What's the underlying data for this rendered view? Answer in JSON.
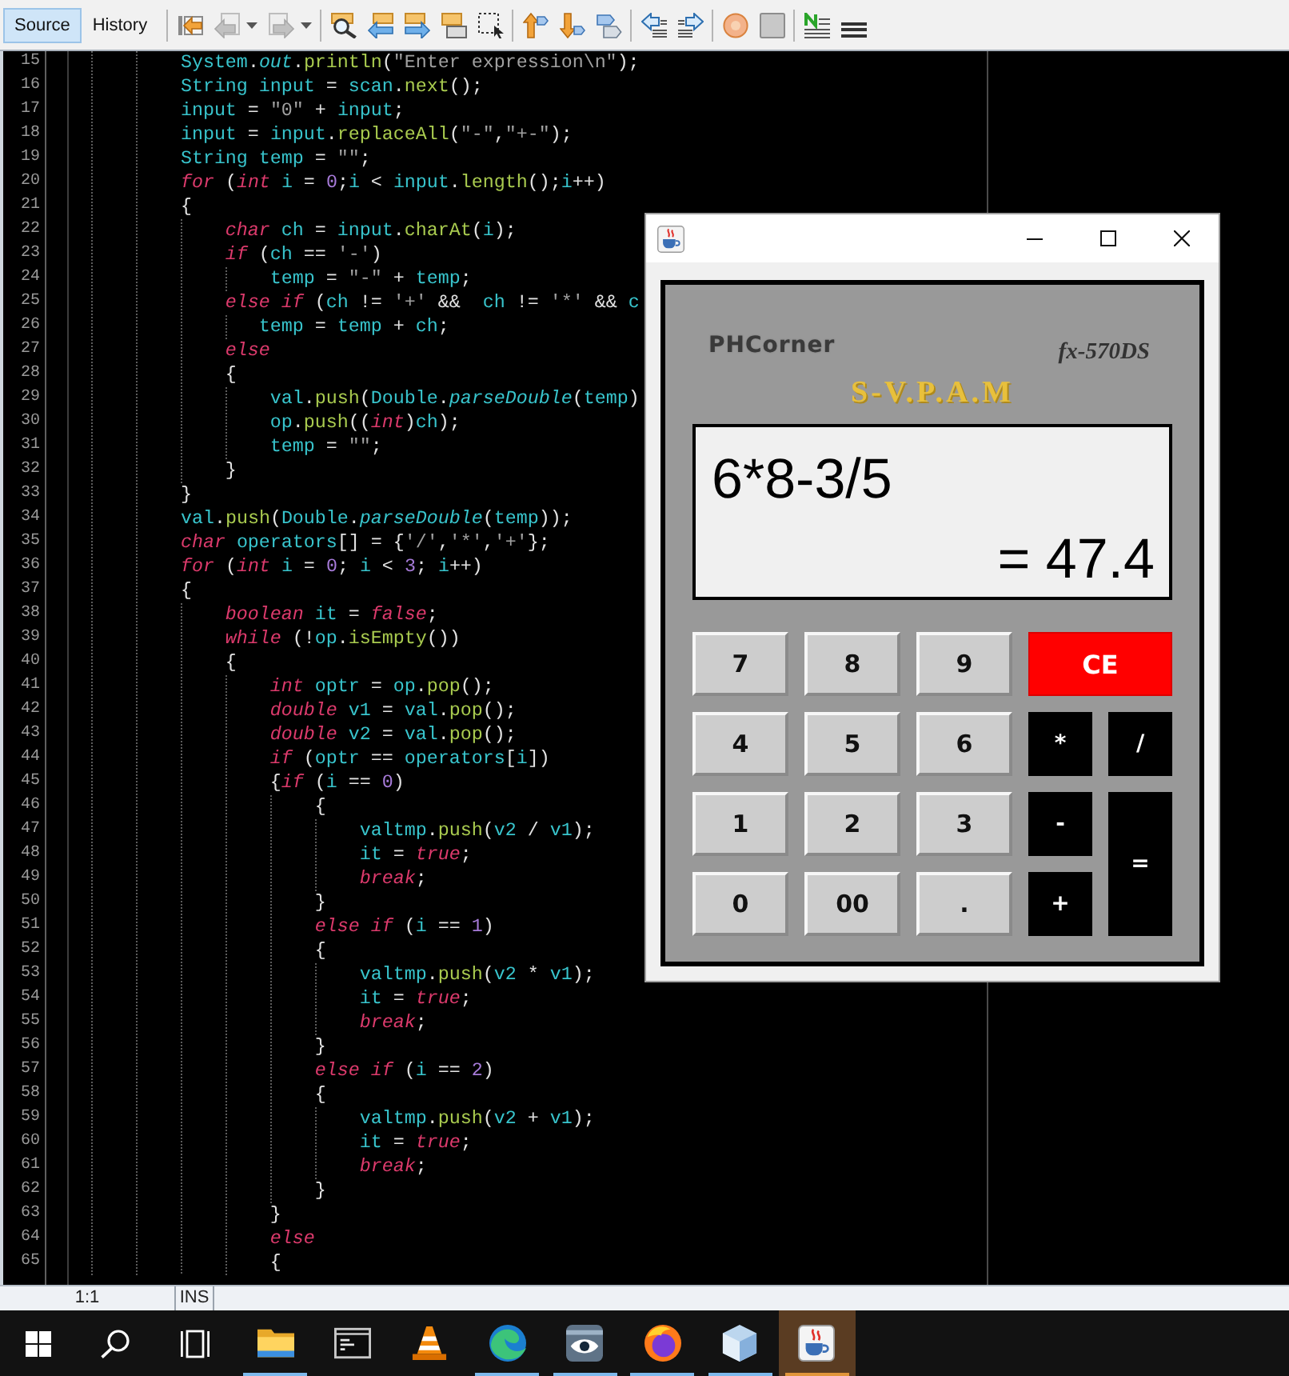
{
  "toolbar": {
    "tabs": [
      {
        "label": "Source",
        "selected": true
      },
      {
        "label": "History",
        "selected": false
      }
    ],
    "groups": [
      {
        "buttons": [
          {
            "kind": "last-edit",
            "disabled": false,
            "menu": false
          },
          {
            "kind": "back",
            "disabled": true,
            "menu": true
          },
          {
            "kind": "forward",
            "disabled": true,
            "menu": true
          }
        ]
      },
      {
        "buttons": [
          {
            "kind": "find",
            "disabled": false,
            "menu": false
          },
          {
            "kind": "find-previous",
            "disabled": false,
            "menu": false
          },
          {
            "kind": "find-next",
            "disabled": false,
            "menu": false
          },
          {
            "kind": "highlight",
            "disabled": false,
            "menu": false
          },
          {
            "kind": "rect-select",
            "disabled": false,
            "menu": false
          }
        ]
      },
      {
        "buttons": [
          {
            "kind": "previous-bookmark",
            "disabled": false,
            "menu": false
          },
          {
            "kind": "next-bookmark",
            "disabled": false,
            "menu": false
          },
          {
            "kind": "toggle-bookmark",
            "disabled": false,
            "menu": false
          }
        ]
      },
      {
        "buttons": [
          {
            "kind": "shift-left",
            "disabled": false,
            "menu": false
          },
          {
            "kind": "shift-right",
            "disabled": false,
            "menu": false
          }
        ]
      },
      {
        "buttons": [
          {
            "kind": "record",
            "disabled": false,
            "menu": false
          },
          {
            "kind": "stop",
            "disabled": false,
            "menu": false
          }
        ]
      },
      {
        "buttons": [
          {
            "kind": "comment",
            "disabled": false,
            "menu": false
          },
          {
            "kind": "uncomment",
            "disabled": false,
            "menu": false
          }
        ]
      }
    ]
  },
  "editor": {
    "lines": [
      {
        "number": "15",
        "tokens": [
          {
            "kind": "name",
            "text": "            System"
          },
          {
            "kind": "plain",
            "text": "."
          },
          {
            "kind": "field",
            "text": "out"
          },
          {
            "kind": "plain",
            "text": "."
          },
          {
            "kind": "method",
            "text": "println"
          },
          {
            "kind": "plain",
            "text": "("
          },
          {
            "kind": "string",
            "text": "\"Enter expression\\n\""
          },
          {
            "kind": "plain",
            "text": ");"
          }
        ]
      },
      {
        "number": "16",
        "tokens": [
          {
            "kind": "name",
            "text": "            String "
          },
          {
            "kind": "name",
            "text": "input"
          },
          {
            "kind": "plain",
            "text": " = "
          },
          {
            "kind": "name",
            "text": "scan"
          },
          {
            "kind": "plain",
            "text": "."
          },
          {
            "kind": "method",
            "text": "next"
          },
          {
            "kind": "plain",
            "text": "();"
          }
        ]
      },
      {
        "number": "17",
        "tokens": [
          {
            "kind": "name",
            "text": "            input"
          },
          {
            "kind": "plain",
            "text": " = "
          },
          {
            "kind": "string",
            "text": "\"0\""
          },
          {
            "kind": "plain",
            "text": " + "
          },
          {
            "kind": "name",
            "text": "input"
          },
          {
            "kind": "plain",
            "text": ";"
          }
        ]
      },
      {
        "number": "18",
        "tokens": [
          {
            "kind": "name",
            "text": "            input"
          },
          {
            "kind": "plain",
            "text": " = "
          },
          {
            "kind": "name",
            "text": "input"
          },
          {
            "kind": "plain",
            "text": "."
          },
          {
            "kind": "method",
            "text": "replaceAll"
          },
          {
            "kind": "plain",
            "text": "("
          },
          {
            "kind": "string",
            "text": "\"-\""
          },
          {
            "kind": "plain",
            "text": ","
          },
          {
            "kind": "string",
            "text": "\"+-\""
          },
          {
            "kind": "plain",
            "text": ");"
          }
        ]
      },
      {
        "number": "19",
        "tokens": [
          {
            "kind": "name",
            "text": "            String "
          },
          {
            "kind": "name",
            "text": "temp"
          },
          {
            "kind": "plain",
            "text": " = "
          },
          {
            "kind": "string",
            "text": "\"\""
          },
          {
            "kind": "plain",
            "text": ";"
          }
        ]
      },
      {
        "number": "20",
        "tokens": [
          {
            "kind": "keyword",
            "text": "            for"
          },
          {
            "kind": "plain",
            "text": " ("
          },
          {
            "kind": "keyword",
            "text": "int "
          },
          {
            "kind": "name",
            "text": "i"
          },
          {
            "kind": "plain",
            "text": " = "
          },
          {
            "kind": "number",
            "text": "0"
          },
          {
            "kind": "plain",
            "text": ";"
          },
          {
            "kind": "name",
            "text": "i"
          },
          {
            "kind": "plain",
            "text": " < "
          },
          {
            "kind": "name",
            "text": "input"
          },
          {
            "kind": "plain",
            "text": "."
          },
          {
            "kind": "method",
            "text": "length"
          },
          {
            "kind": "plain",
            "text": "();"
          },
          {
            "kind": "name",
            "text": "i"
          },
          {
            "kind": "plain",
            "text": "++)"
          }
        ]
      },
      {
        "number": "21",
        "tokens": [
          {
            "kind": "plain",
            "text": "            {"
          }
        ]
      },
      {
        "number": "22",
        "tokens": [
          {
            "kind": "keyword",
            "text": "                char "
          },
          {
            "kind": "name",
            "text": "ch"
          },
          {
            "kind": "plain",
            "text": " = "
          },
          {
            "kind": "name",
            "text": "input"
          },
          {
            "kind": "plain",
            "text": "."
          },
          {
            "kind": "method",
            "text": "charAt"
          },
          {
            "kind": "plain",
            "text": "("
          },
          {
            "kind": "name",
            "text": "i"
          },
          {
            "kind": "plain",
            "text": ");"
          }
        ]
      },
      {
        "number": "23",
        "tokens": [
          {
            "kind": "keyword",
            "text": "                if"
          },
          {
            "kind": "plain",
            "text": " ("
          },
          {
            "kind": "name",
            "text": "ch"
          },
          {
            "kind": "plain",
            "text": " == "
          },
          {
            "kind": "string",
            "text": "'-'"
          },
          {
            "kind": "plain",
            "text": ")"
          }
        ]
      },
      {
        "number": "24",
        "tokens": [
          {
            "kind": "name",
            "text": "                    temp"
          },
          {
            "kind": "plain",
            "text": " = "
          },
          {
            "kind": "string",
            "text": "\"-\""
          },
          {
            "kind": "plain",
            "text": " + "
          },
          {
            "kind": "name",
            "text": "temp"
          },
          {
            "kind": "plain",
            "text": ";"
          }
        ]
      },
      {
        "number": "25",
        "tokens": [
          {
            "kind": "keyword",
            "text": "                else if"
          },
          {
            "kind": "plain",
            "text": " ("
          },
          {
            "kind": "name",
            "text": "ch"
          },
          {
            "kind": "plain",
            "text": " != "
          },
          {
            "kind": "string",
            "text": "'+'"
          },
          {
            "kind": "plain",
            "text": " &&  "
          },
          {
            "kind": "name",
            "text": "ch"
          },
          {
            "kind": "plain",
            "text": " != "
          },
          {
            "kind": "string",
            "text": "'*'"
          },
          {
            "kind": "plain",
            "text": " && "
          },
          {
            "kind": "name",
            "text": "c"
          }
        ]
      },
      {
        "number": "26",
        "tokens": [
          {
            "kind": "name",
            "text": "                   temp"
          },
          {
            "kind": "plain",
            "text": " = "
          },
          {
            "kind": "name",
            "text": "temp"
          },
          {
            "kind": "plain",
            "text": " + "
          },
          {
            "kind": "name",
            "text": "ch"
          },
          {
            "kind": "plain",
            "text": ";"
          }
        ]
      },
      {
        "number": "27",
        "tokens": [
          {
            "kind": "keyword",
            "text": "                else"
          }
        ]
      },
      {
        "number": "28",
        "tokens": [
          {
            "kind": "plain",
            "text": "                {"
          }
        ]
      },
      {
        "number": "29",
        "tokens": [
          {
            "kind": "name",
            "text": "                    val"
          },
          {
            "kind": "plain",
            "text": "."
          },
          {
            "kind": "method",
            "text": "push"
          },
          {
            "kind": "plain",
            "text": "("
          },
          {
            "kind": "name",
            "text": "Double"
          },
          {
            "kind": "plain",
            "text": "."
          },
          {
            "kind": "field",
            "text": "parseDouble"
          },
          {
            "kind": "plain",
            "text": "("
          },
          {
            "kind": "name",
            "text": "temp"
          },
          {
            "kind": "plain",
            "text": ")"
          }
        ]
      },
      {
        "number": "30",
        "tokens": [
          {
            "kind": "name",
            "text": "                    op"
          },
          {
            "kind": "plain",
            "text": "."
          },
          {
            "kind": "method",
            "text": "push"
          },
          {
            "kind": "plain",
            "text": "(("
          },
          {
            "kind": "keyword",
            "text": "int"
          },
          {
            "kind": "plain",
            "text": ")"
          },
          {
            "kind": "name",
            "text": "ch"
          },
          {
            "kind": "plain",
            "text": ");"
          }
        ]
      },
      {
        "number": "31",
        "tokens": [
          {
            "kind": "name",
            "text": "                    temp"
          },
          {
            "kind": "plain",
            "text": " = "
          },
          {
            "kind": "string",
            "text": "\"\""
          },
          {
            "kind": "plain",
            "text": ";"
          }
        ]
      },
      {
        "number": "32",
        "tokens": [
          {
            "kind": "plain",
            "text": "                }"
          }
        ]
      },
      {
        "number": "33",
        "tokens": [
          {
            "kind": "plain",
            "text": "            }"
          }
        ]
      },
      {
        "number": "34",
        "tokens": [
          {
            "kind": "name",
            "text": "            val"
          },
          {
            "kind": "plain",
            "text": "."
          },
          {
            "kind": "method",
            "text": "push"
          },
          {
            "kind": "plain",
            "text": "("
          },
          {
            "kind": "name",
            "text": "Double"
          },
          {
            "kind": "plain",
            "text": "."
          },
          {
            "kind": "field",
            "text": "parseDouble"
          },
          {
            "kind": "plain",
            "text": "("
          },
          {
            "kind": "name",
            "text": "temp"
          },
          {
            "kind": "plain",
            "text": "));"
          }
        ]
      },
      {
        "number": "35",
        "tokens": [
          {
            "kind": "keyword",
            "text": "            char "
          },
          {
            "kind": "name",
            "text": "operators"
          },
          {
            "kind": "plain",
            "text": "[] = {"
          },
          {
            "kind": "string",
            "text": "'/'"
          },
          {
            "kind": "plain",
            "text": ","
          },
          {
            "kind": "string",
            "text": "'*'"
          },
          {
            "kind": "plain",
            "text": ","
          },
          {
            "kind": "string",
            "text": "'+'"
          },
          {
            "kind": "plain",
            "text": "};"
          }
        ]
      },
      {
        "number": "36",
        "tokens": [
          {
            "kind": "keyword",
            "text": "            for"
          },
          {
            "kind": "plain",
            "text": " ("
          },
          {
            "kind": "keyword",
            "text": "int "
          },
          {
            "kind": "name",
            "text": "i"
          },
          {
            "kind": "plain",
            "text": " = "
          },
          {
            "kind": "number",
            "text": "0"
          },
          {
            "kind": "plain",
            "text": "; "
          },
          {
            "kind": "name",
            "text": "i"
          },
          {
            "kind": "plain",
            "text": " < "
          },
          {
            "kind": "number",
            "text": "3"
          },
          {
            "kind": "plain",
            "text": "; "
          },
          {
            "kind": "name",
            "text": "i"
          },
          {
            "kind": "plain",
            "text": "++)"
          }
        ]
      },
      {
        "number": "37",
        "tokens": [
          {
            "kind": "plain",
            "text": "            {"
          }
        ]
      },
      {
        "number": "38",
        "tokens": [
          {
            "kind": "keyword",
            "text": "                boolean "
          },
          {
            "kind": "name",
            "text": "it"
          },
          {
            "kind": "plain",
            "text": " = "
          },
          {
            "kind": "keyword",
            "text": "false"
          },
          {
            "kind": "plain",
            "text": ";"
          }
        ]
      },
      {
        "number": "39",
        "tokens": [
          {
            "kind": "keyword",
            "text": "                while"
          },
          {
            "kind": "plain",
            "text": " (!"
          },
          {
            "kind": "name",
            "text": "op"
          },
          {
            "kind": "plain",
            "text": "."
          },
          {
            "kind": "method",
            "text": "isEmpty"
          },
          {
            "kind": "plain",
            "text": "())"
          }
        ]
      },
      {
        "number": "40",
        "tokens": [
          {
            "kind": "plain",
            "text": "                {"
          }
        ]
      },
      {
        "number": "41",
        "tokens": [
          {
            "kind": "keyword",
            "text": "                    int "
          },
          {
            "kind": "name",
            "text": "optr"
          },
          {
            "kind": "plain",
            "text": " = "
          },
          {
            "kind": "name",
            "text": "op"
          },
          {
            "kind": "plain",
            "text": "."
          },
          {
            "kind": "method",
            "text": "pop"
          },
          {
            "kind": "plain",
            "text": "();"
          }
        ]
      },
      {
        "number": "42",
        "tokens": [
          {
            "kind": "keyword",
            "text": "                    double "
          },
          {
            "kind": "name",
            "text": "v1"
          },
          {
            "kind": "plain",
            "text": " = "
          },
          {
            "kind": "name",
            "text": "val"
          },
          {
            "kind": "plain",
            "text": "."
          },
          {
            "kind": "method",
            "text": "pop"
          },
          {
            "kind": "plain",
            "text": "();"
          }
        ]
      },
      {
        "number": "43",
        "tokens": [
          {
            "kind": "keyword",
            "text": "                    double "
          },
          {
            "kind": "name",
            "text": "v2"
          },
          {
            "kind": "plain",
            "text": " = "
          },
          {
            "kind": "name",
            "text": "val"
          },
          {
            "kind": "plain",
            "text": "."
          },
          {
            "kind": "method",
            "text": "pop"
          },
          {
            "kind": "plain",
            "text": "();"
          }
        ]
      },
      {
        "number": "44",
        "tokens": [
          {
            "kind": "keyword",
            "text": "                    if"
          },
          {
            "kind": "plain",
            "text": " ("
          },
          {
            "kind": "name",
            "text": "optr"
          },
          {
            "kind": "plain",
            "text": " == "
          },
          {
            "kind": "name",
            "text": "operators"
          },
          {
            "kind": "plain",
            "text": "["
          },
          {
            "kind": "name",
            "text": "i"
          },
          {
            "kind": "plain",
            "text": "])"
          }
        ]
      },
      {
        "number": "45",
        "tokens": [
          {
            "kind": "plain",
            "text": "                    {"
          },
          {
            "kind": "keyword",
            "text": "if"
          },
          {
            "kind": "plain",
            "text": " ("
          },
          {
            "kind": "name",
            "text": "i"
          },
          {
            "kind": "plain",
            "text": " == "
          },
          {
            "kind": "number",
            "text": "0"
          },
          {
            "kind": "plain",
            "text": ")"
          }
        ]
      },
      {
        "number": "46",
        "tokens": [
          {
            "kind": "plain",
            "text": "                        {"
          }
        ]
      },
      {
        "number": "47",
        "tokens": [
          {
            "kind": "name",
            "text": "                            valtmp"
          },
          {
            "kind": "plain",
            "text": "."
          },
          {
            "kind": "method",
            "text": "push"
          },
          {
            "kind": "plain",
            "text": "("
          },
          {
            "kind": "name",
            "text": "v2"
          },
          {
            "kind": "plain",
            "text": " / "
          },
          {
            "kind": "name",
            "text": "v1"
          },
          {
            "kind": "plain",
            "text": ");"
          }
        ]
      },
      {
        "number": "48",
        "tokens": [
          {
            "kind": "name",
            "text": "                            it"
          },
          {
            "kind": "plain",
            "text": " = "
          },
          {
            "kind": "keyword",
            "text": "true"
          },
          {
            "kind": "plain",
            "text": ";"
          }
        ]
      },
      {
        "number": "49",
        "tokens": [
          {
            "kind": "keyword",
            "text": "                            break"
          },
          {
            "kind": "plain",
            "text": ";"
          }
        ]
      },
      {
        "number": "50",
        "tokens": [
          {
            "kind": "plain",
            "text": "                        }"
          }
        ]
      },
      {
        "number": "51",
        "tokens": [
          {
            "kind": "keyword",
            "text": "                        else if"
          },
          {
            "kind": "plain",
            "text": " ("
          },
          {
            "kind": "name",
            "text": "i"
          },
          {
            "kind": "plain",
            "text": " == "
          },
          {
            "kind": "number",
            "text": "1"
          },
          {
            "kind": "plain",
            "text": ")"
          }
        ]
      },
      {
        "number": "52",
        "tokens": [
          {
            "kind": "plain",
            "text": "                        {"
          }
        ]
      },
      {
        "number": "53",
        "tokens": [
          {
            "kind": "name",
            "text": "                            valtmp"
          },
          {
            "kind": "plain",
            "text": "."
          },
          {
            "kind": "method",
            "text": "push"
          },
          {
            "kind": "plain",
            "text": "("
          },
          {
            "kind": "name",
            "text": "v2"
          },
          {
            "kind": "plain",
            "text": " * "
          },
          {
            "kind": "name",
            "text": "v1"
          },
          {
            "kind": "plain",
            "text": ");"
          }
        ]
      },
      {
        "number": "54",
        "tokens": [
          {
            "kind": "name",
            "text": "                            it"
          },
          {
            "kind": "plain",
            "text": " = "
          },
          {
            "kind": "keyword",
            "text": "true"
          },
          {
            "kind": "plain",
            "text": ";"
          }
        ]
      },
      {
        "number": "55",
        "tokens": [
          {
            "kind": "keyword",
            "text": "                            break"
          },
          {
            "kind": "plain",
            "text": ";"
          }
        ]
      },
      {
        "number": "56",
        "tokens": [
          {
            "kind": "plain",
            "text": "                        }"
          }
        ]
      },
      {
        "number": "57",
        "tokens": [
          {
            "kind": "keyword",
            "text": "                        else if"
          },
          {
            "kind": "plain",
            "text": " ("
          },
          {
            "kind": "name",
            "text": "i"
          },
          {
            "kind": "plain",
            "text": " == "
          },
          {
            "kind": "number",
            "text": "2"
          },
          {
            "kind": "plain",
            "text": ")"
          }
        ]
      },
      {
        "number": "58",
        "tokens": [
          {
            "kind": "plain",
            "text": "                        {"
          }
        ]
      },
      {
        "number": "59",
        "tokens": [
          {
            "kind": "name",
            "text": "                            valtmp"
          },
          {
            "kind": "plain",
            "text": "."
          },
          {
            "kind": "method",
            "text": "push"
          },
          {
            "kind": "plain",
            "text": "("
          },
          {
            "kind": "name",
            "text": "v2"
          },
          {
            "kind": "plain",
            "text": " + "
          },
          {
            "kind": "name",
            "text": "v1"
          },
          {
            "kind": "plain",
            "text": ");"
          }
        ]
      },
      {
        "number": "60",
        "tokens": [
          {
            "kind": "name",
            "text": "                            it"
          },
          {
            "kind": "plain",
            "text": " = "
          },
          {
            "kind": "keyword",
            "text": "true"
          },
          {
            "kind": "plain",
            "text": ";"
          }
        ]
      },
      {
        "number": "61",
        "tokens": [
          {
            "kind": "keyword",
            "text": "                            break"
          },
          {
            "kind": "plain",
            "text": ";"
          }
        ]
      },
      {
        "number": "62",
        "tokens": [
          {
            "kind": "plain",
            "text": "                        }"
          }
        ]
      },
      {
        "number": "63",
        "tokens": [
          {
            "kind": "plain",
            "text": "                    }"
          }
        ]
      },
      {
        "number": "64",
        "tokens": [
          {
            "kind": "keyword",
            "text": "                    else"
          }
        ]
      },
      {
        "number": "65",
        "tokens": [
          {
            "kind": "plain",
            "text": "                    {"
          }
        ]
      }
    ]
  },
  "calculator": {
    "brand": "PHCorner",
    "model": "fx-570DS",
    "mode": "S-V.P.A.M",
    "display": {
      "expression": "6*8-3/5",
      "result": "= 47.4"
    },
    "keys": [
      {
        "label": "7",
        "kind": "digit"
      },
      {
        "label": "8",
        "kind": "digit"
      },
      {
        "label": "9",
        "kind": "digit"
      },
      {
        "label": "CE",
        "kind": "clear"
      },
      {
        "label": "4",
        "kind": "digit"
      },
      {
        "label": "5",
        "kind": "digit"
      },
      {
        "label": "6",
        "kind": "digit"
      },
      {
        "label": "*",
        "kind": "operator"
      },
      {
        "label": "/",
        "kind": "operator"
      },
      {
        "label": "1",
        "kind": "digit"
      },
      {
        "label": "2",
        "kind": "digit"
      },
      {
        "label": "3",
        "kind": "digit"
      },
      {
        "label": "-",
        "kind": "operator"
      },
      {
        "label": "=",
        "kind": "equals"
      },
      {
        "label": "0",
        "kind": "digit"
      },
      {
        "label": "00",
        "kind": "digit"
      },
      {
        "label": ".",
        "kind": "digit"
      },
      {
        "label": "+",
        "kind": "operator"
      }
    ]
  },
  "status_bar": {
    "position": "1:1",
    "mode": "INS"
  },
  "taskbar": {
    "buttons": [
      {
        "kind": "start"
      },
      {
        "kind": "search"
      },
      {
        "kind": "task-view"
      }
    ],
    "apps": [
      {
        "kind": "folder",
        "running": true,
        "highlighted": false
      },
      {
        "kind": "terminal",
        "running": false,
        "highlighted": false
      },
      {
        "kind": "cone",
        "running": false,
        "highlighted": false
      },
      {
        "kind": "swirl",
        "running": true,
        "highlighted": false
      },
      {
        "kind": "eye",
        "running": true,
        "highlighted": false
      },
      {
        "kind": "globe",
        "running": true,
        "highlighted": false
      },
      {
        "kind": "cube",
        "running": true,
        "highlighted": false
      },
      {
        "kind": "cup",
        "running": true,
        "highlighted": true
      }
    ]
  }
}
